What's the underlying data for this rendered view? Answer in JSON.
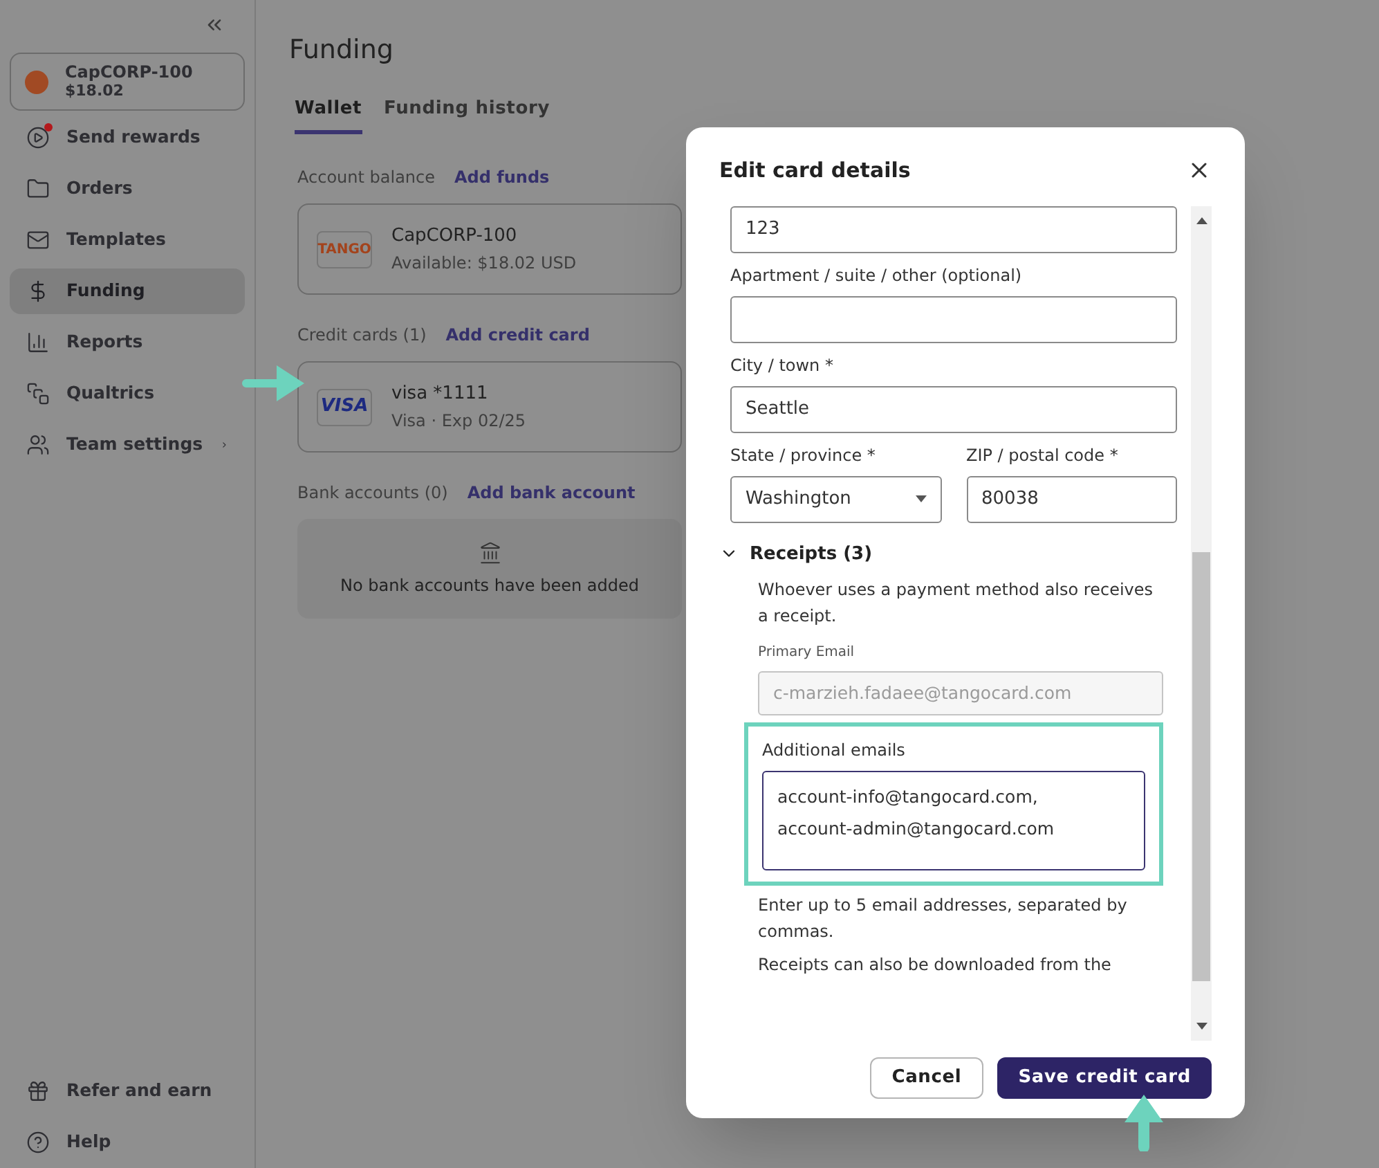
{
  "sidebar": {
    "account": {
      "name": "CapCORP-100",
      "balance": "$18.02"
    },
    "items": [
      {
        "label": "Send rewards",
        "selected": false,
        "alert": true,
        "submenu": false
      },
      {
        "label": "Orders",
        "selected": false,
        "alert": false,
        "submenu": false
      },
      {
        "label": "Templates",
        "selected": false,
        "alert": false,
        "submenu": false
      },
      {
        "label": "Funding",
        "selected": true,
        "alert": false,
        "submenu": false
      },
      {
        "label": "Reports",
        "selected": false,
        "alert": false,
        "submenu": false
      },
      {
        "label": "Qualtrics",
        "selected": false,
        "alert": false,
        "submenu": false
      },
      {
        "label": "Team settings",
        "selected": false,
        "alert": false,
        "submenu": true
      }
    ],
    "footer_items": [
      {
        "label": "Refer and earn"
      },
      {
        "label": "Help"
      }
    ]
  },
  "page": {
    "title": "Funding",
    "tabs": [
      {
        "label": "Wallet",
        "selected": true
      },
      {
        "label": "Funding history",
        "selected": false
      }
    ],
    "balance": {
      "label": "Account balance",
      "action": "Add funds",
      "logo": "TANGO",
      "name": "CapCORP-100",
      "detail": "Available: $18.02 USD"
    },
    "credit_cards": {
      "label": "Credit cards (1)",
      "action": "Add credit card",
      "logo": "VISA",
      "name": "visa *1111",
      "detail": "Visa · Exp 02/25"
    },
    "bank_accounts": {
      "label": "Bank accounts (0)",
      "action": "Add bank account",
      "empty": "No bank accounts have been added"
    }
  },
  "modal": {
    "title": "Edit card details",
    "fields": [
      {
        "kind": "text",
        "value": "123"
      },
      {
        "kind": "text",
        "label": "Apartment / suite / other (optional)"
      },
      {
        "kind": "text",
        "label": "City / town *",
        "value": "Seattle"
      }
    ],
    "row_fields": [
      {
        "kind": "select",
        "label": "State / province *",
        "value": "Washington"
      },
      {
        "kind": "text",
        "label": "ZIP / postal code *",
        "value": "80038"
      }
    ],
    "receipts": {
      "title": "Receipts (3)",
      "expanded": true,
      "description": "Whoever uses a payment method also receives a receipt.",
      "primary_email": {
        "label": "Primary Email",
        "value": "c-marzieh.fadaee@tangocard.com",
        "disabled": true
      },
      "additional_emails": {
        "label": "Additional emails",
        "lines": [
          "account-info@tangocard.com,",
          "account-admin@tangocard.com"
        ],
        "highlighted": true
      },
      "hint": "Enter up to 5 email addresses, separated by commas.",
      "note": "Receipts can also be downloaded from the"
    },
    "buttons": [
      {
        "label": "Cancel",
        "kind": "secondary"
      },
      {
        "label": "Save credit card",
        "kind": "primary"
      }
    ]
  }
}
